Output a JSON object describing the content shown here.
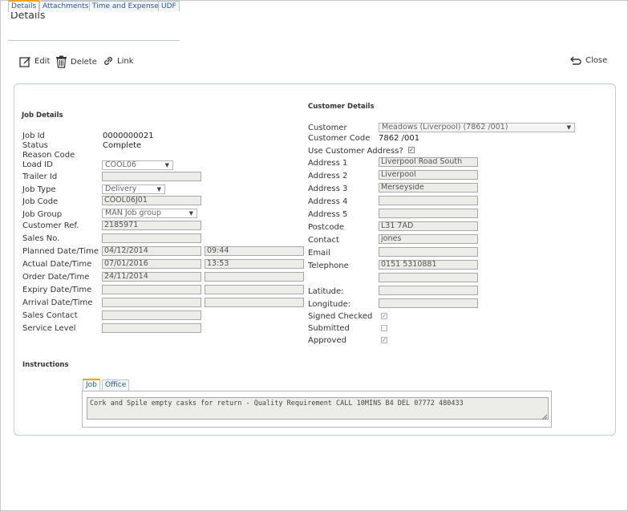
{
  "page": {
    "title": "Details"
  },
  "tabs": [
    "Details",
    "Attachments",
    "Time and Expense",
    "UDF"
  ],
  "toolbar": {
    "edit": "Edit",
    "delete": "Delete",
    "link": "Link",
    "close": "Close"
  },
  "job_details": {
    "title": "Job Details",
    "job_id_label": "Job Id",
    "job_id": "0000000021",
    "status_label": "Status",
    "status": "Complete",
    "reason_code_label": "Reason Code",
    "load_id_label": "Load ID",
    "load_id": "COOL06",
    "trailer_id_label": "Trailer Id",
    "job_type_label": "Job Type",
    "job_type": "Delivery",
    "job_code_label": "Job Code",
    "job_code": "COOL06J01",
    "job_group_label": "Job Group",
    "job_group": "MAN Job group",
    "customer_ref_label": "Customer Ref.",
    "customer_ref": "2185971",
    "sales_no_label": "Sales No.",
    "planned_label": "Planned Date/Time",
    "planned_date": "04/12/2014",
    "planned_time": "09:44",
    "actual_label": "Actual Date/Time",
    "actual_date": "07/01/2016",
    "actual_time": "13:53",
    "order_label": "Order Date/Time",
    "order_date": "24/11/2014",
    "expiry_label": "Expiry Date/Time",
    "arrival_label": "Arrival Date/Time",
    "sales_contact_label": "Sales Contact",
    "service_level_label": "Service Level"
  },
  "customer_details": {
    "title": "Customer Details",
    "customer_label": "Customer",
    "customer": "Meadows (Liverpool) (7862 /001)",
    "customer_code_label": "Customer Code",
    "customer_code": "7862 /001",
    "use_address_label": "Use Customer Address?",
    "use_address": true,
    "address1_label": "Address 1",
    "address1": "Liverpool Road South",
    "address2_label": "Address 2",
    "address2": "Liverpool",
    "address3_label": "Address 3",
    "address3": "Merseyside",
    "address4_label": "Address 4",
    "address5_label": "Address 5",
    "postcode_label": "Postcode",
    "postcode": "L31 7AD",
    "contact_label": "Contact",
    "contact": "jones",
    "email_label": "Email",
    "telephone_label": "Telephone",
    "telephone": "0151 5310881",
    "latitude_label": "Latitude:",
    "longitude_label": "Longitude:",
    "signed_checked_label": "Signed Checked",
    "signed_checked": true,
    "submitted_label": "Submitted",
    "submitted": false,
    "approved_label": "Approved",
    "approved": true
  },
  "instructions": {
    "title": "Instructions",
    "tabs": [
      "Job",
      "Office"
    ],
    "text": "Cork and Spile empty casks for return - Quality Requirement CALL 10MINS B4 DEL 07772 480433"
  }
}
